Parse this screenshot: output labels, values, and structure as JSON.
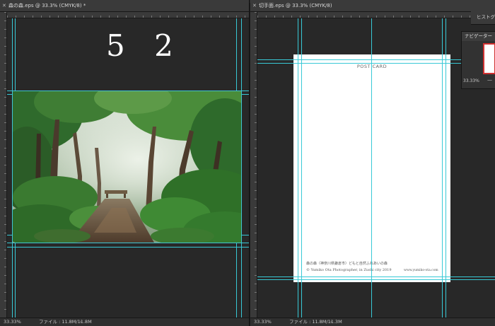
{
  "left_document": {
    "tab_title": "森の森.eps @ 33.3% (CMYK/8) *",
    "overlay_text": "5 2",
    "status_zoom": "33.33%",
    "status_file": "ファイル : 11.8M/11.8M",
    "ruler_numbers": [
      "0",
      "1",
      "2",
      "3",
      "4",
      "5"
    ]
  },
  "right_document": {
    "tab_title": "切手面.eps @ 33.3% (CMYK/8)",
    "status_zoom": "33.33%",
    "status_file": "ファイル : 11.8M/11.3M",
    "postcard": {
      "title": "POST CARD",
      "caption": "森の森（神奈川県鎌倉市）どもと自然ふれあいの森",
      "credit": "© Yumiko Ota Photographer, in Zushi city 2019",
      "website": "www.yumiko-ota.com"
    }
  },
  "panels": {
    "histogram_label": "ヒストグラム",
    "navigator_label": "ナビゲーター",
    "navigator_zoom": "33.33%"
  },
  "colors": {
    "guide": "#38c9d6",
    "workspace": "#282828",
    "navigator_frame": "#d03030"
  }
}
